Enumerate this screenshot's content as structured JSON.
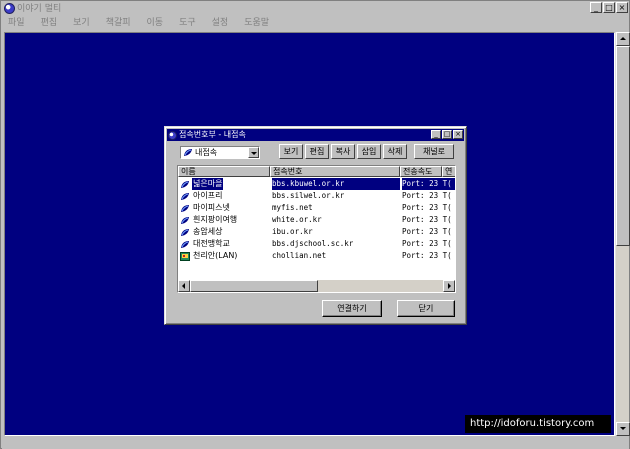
{
  "window": {
    "title": "이야기 멀티",
    "controls": [
      "_",
      "□",
      "×"
    ]
  },
  "menu": [
    "파일",
    "편집",
    "보기",
    "책갈피",
    "이동",
    "도구",
    "설정",
    "도움말"
  ],
  "watermark": "http://idoforu.tistory.com",
  "dialog": {
    "title": "접속번호부 - 내접속",
    "controls": [
      "_",
      "□",
      "×"
    ],
    "combo_value": "내접속",
    "toolbar": {
      "view": "보기",
      "edit": "편집",
      "copy": "복사",
      "insert": "삽입",
      "delete": "삭제",
      "channel": "채널로"
    },
    "columns": [
      "이름",
      "접속번호",
      "전송속도",
      "연"
    ],
    "rows": [
      {
        "name": "넓은마을",
        "address": "bbs.kbuwel.or.kr",
        "port": "Port:  23  T(",
        "icon": "telnet-icon",
        "selected": true
      },
      {
        "name": "아이프리",
        "address": "bbs.silwel.or.kr",
        "port": "Port:  23  T(",
        "icon": "telnet-icon"
      },
      {
        "name": "마이피스넷",
        "address": "myfis.net",
        "port": "Port:  23  T(",
        "icon": "telnet-icon"
      },
      {
        "name": "흰지팡이여행",
        "address": "white.or.kr",
        "port": "Port:  23  T(",
        "icon": "telnet-icon"
      },
      {
        "name": "송암세상",
        "address": "ibu.or.kr",
        "port": "Port:  23  T(",
        "icon": "telnet-icon"
      },
      {
        "name": "대전맹학교",
        "address": "bbs.djschool.sc.kr",
        "port": "Port:  23  T(",
        "icon": "telnet-icon"
      },
      {
        "name": "천리안(LAN)",
        "address": "chollian.net",
        "port": "Port:  23  T(",
        "icon": "lan-icon"
      }
    ],
    "connect_label": "연결하기",
    "close_label": "닫기"
  }
}
